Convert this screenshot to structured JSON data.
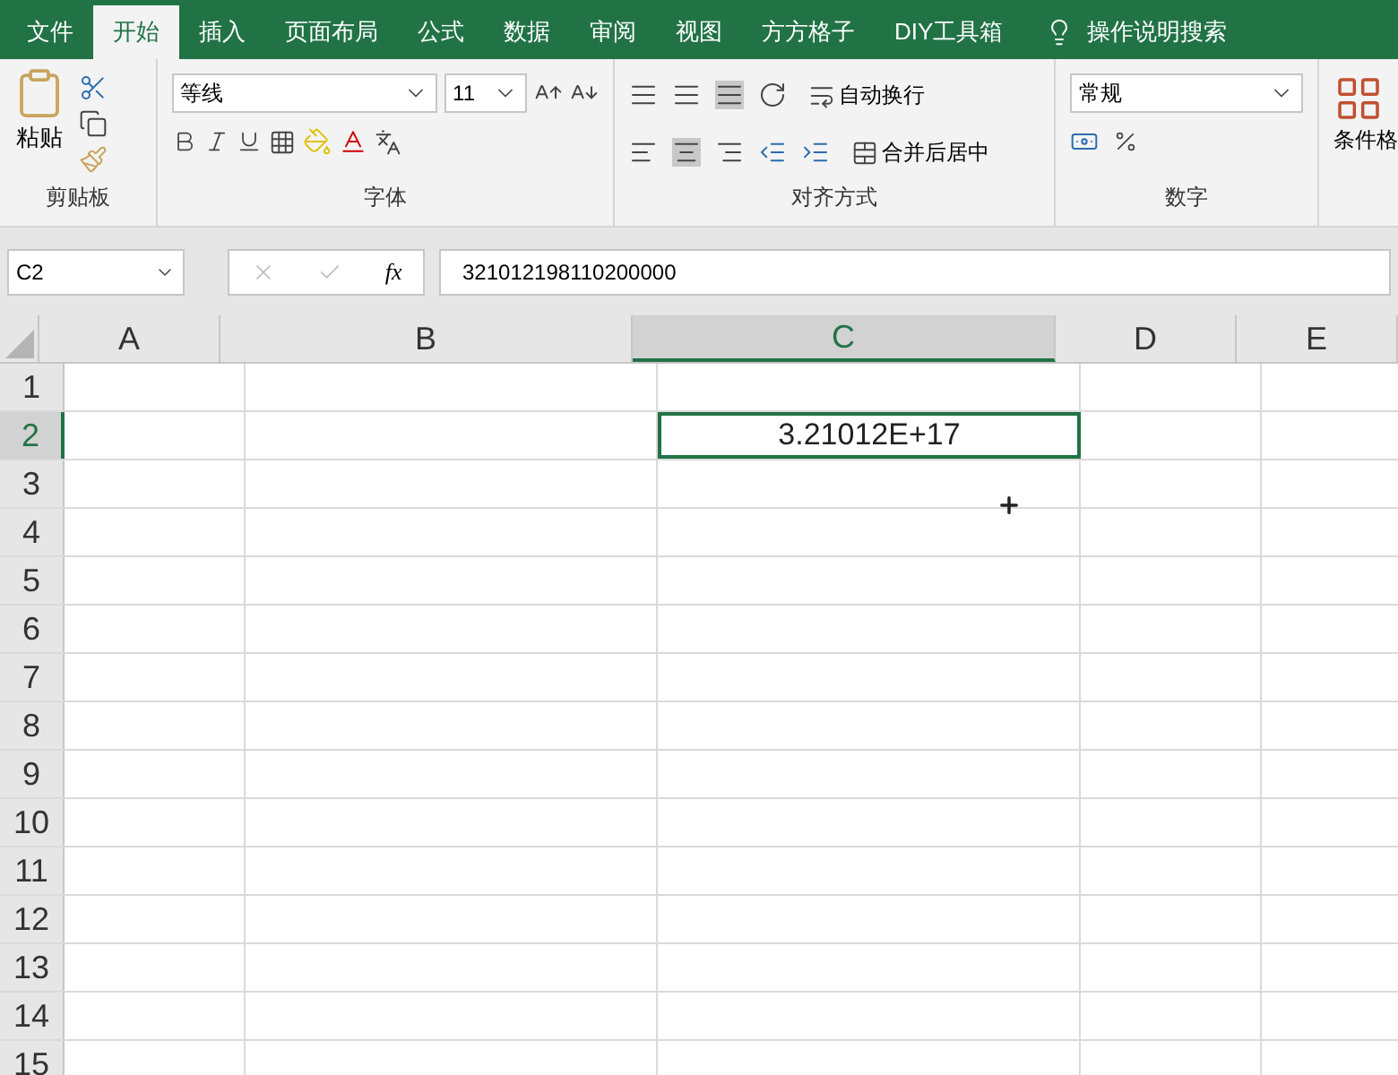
{
  "tabs": [
    {
      "label": "文件",
      "selected": false
    },
    {
      "label": "开始",
      "selected": true
    },
    {
      "label": "插入",
      "selected": false
    },
    {
      "label": "页面布局",
      "selected": false
    },
    {
      "label": "公式",
      "selected": false
    },
    {
      "label": "数据",
      "selected": false
    },
    {
      "label": "审阅",
      "selected": false
    },
    {
      "label": "视图",
      "selected": false
    },
    {
      "label": "方方格子",
      "selected": false
    },
    {
      "label": "DIY工具箱",
      "selected": false
    }
  ],
  "tell_me": "操作说明搜索",
  "ribbon": {
    "clipboard": {
      "paste": "粘贴",
      "label": "剪贴板"
    },
    "font": {
      "font_name": "等线",
      "font_size": "11",
      "label": "字体"
    },
    "alignment": {
      "wrap_text": "自动换行",
      "merge_center": "合并后居中",
      "label": "对齐方式"
    },
    "number": {
      "format": "常规",
      "label": "数字"
    },
    "styles": {
      "conditional_format": "条件格"
    }
  },
  "formula_bar": {
    "name_box": "C2",
    "function_label": "fx",
    "formula": "321012198110200000"
  },
  "columns": [
    {
      "label": "A",
      "selected": false
    },
    {
      "label": "B",
      "selected": false
    },
    {
      "label": "C",
      "selected": true
    },
    {
      "label": "D",
      "selected": false
    },
    {
      "label": "E",
      "selected": false
    }
  ],
  "rows": [
    {
      "label": "1",
      "selected": false
    },
    {
      "label": "2",
      "selected": true
    },
    {
      "label": "3",
      "selected": false
    },
    {
      "label": "4",
      "selected": false
    },
    {
      "label": "5",
      "selected": false
    },
    {
      "label": "6",
      "selected": false
    },
    {
      "label": "7",
      "selected": false
    },
    {
      "label": "8",
      "selected": false
    },
    {
      "label": "9",
      "selected": false
    },
    {
      "label": "10",
      "selected": false
    },
    {
      "label": "11",
      "selected": false
    },
    {
      "label": "12",
      "selected": false
    },
    {
      "label": "13",
      "selected": false
    },
    {
      "label": "14",
      "selected": false
    },
    {
      "label": "15",
      "selected": false
    }
  ],
  "active_cell": {
    "value": "3.21012E+17"
  }
}
